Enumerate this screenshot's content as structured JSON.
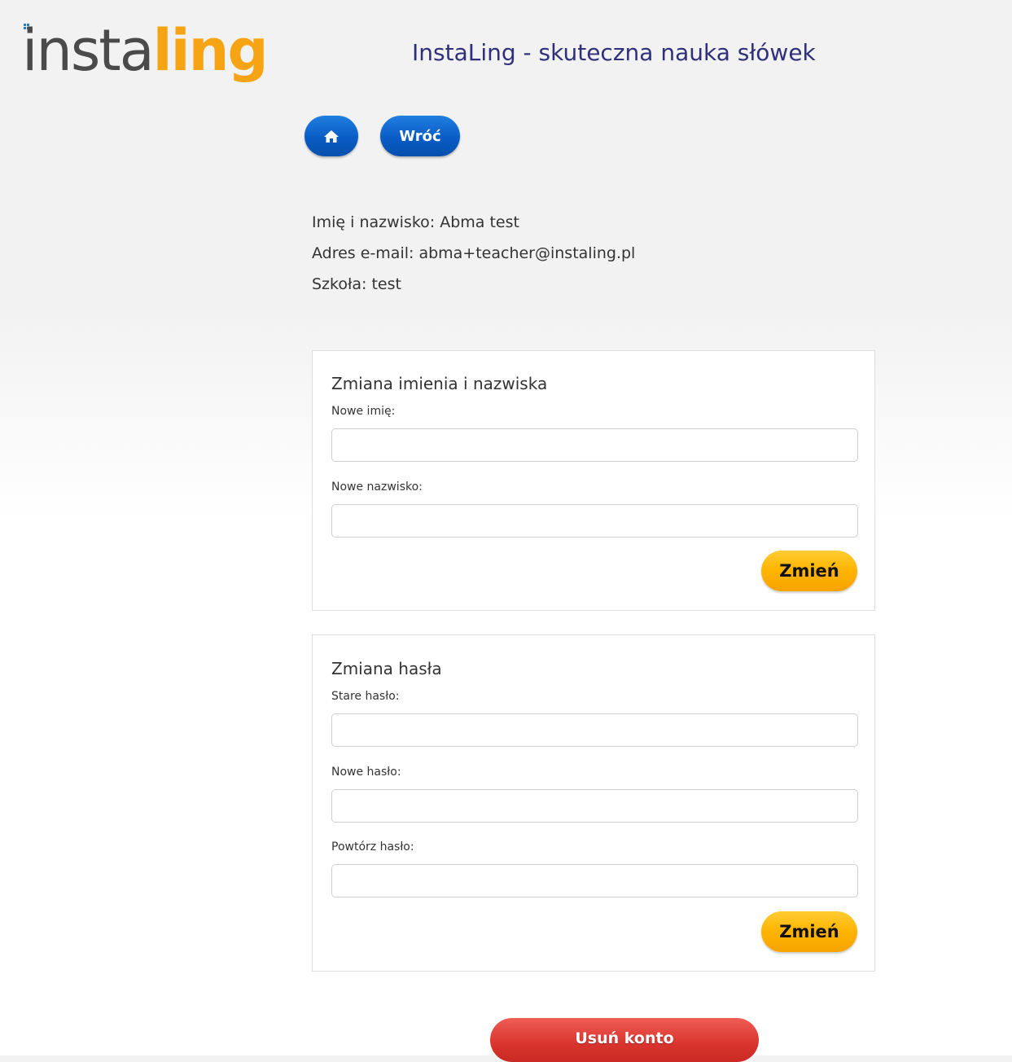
{
  "header": {
    "logo_part1": "insta",
    "logo_part2": "ling",
    "site_title": "InstaLing - skuteczna nauka słówek"
  },
  "nav": {
    "home_icon": "home-icon",
    "back_label": "Wróć"
  },
  "user_info": {
    "name_line": "Imię i nazwisko: Abma test",
    "email_line": "Adres e-mail: abma+teacher@instaling.pl",
    "school_line": "Szkoła: test"
  },
  "name_form": {
    "title": "Zmiana imienia i nazwiska",
    "first_name_label": "Nowe imię:",
    "first_name_value": "",
    "last_name_label": "Nowe nazwisko:",
    "last_name_value": "",
    "submit_label": "Zmień"
  },
  "password_form": {
    "title": "Zmiana hasła",
    "old_password_label": "Stare hasło:",
    "old_password_value": "",
    "new_password_label": "Nowe hasło:",
    "new_password_value": "",
    "repeat_password_label": "Powtórz hasło:",
    "repeat_password_value": "",
    "submit_label": "Zmień"
  },
  "delete_account": {
    "label": "Usuń konto"
  },
  "colors": {
    "logo_gray": "#4a4a4a",
    "logo_orange": "#f7a414",
    "title_navy": "#2f2f7a",
    "nav_blue": "#0a5cc5",
    "submit_yellow": "#ffb400",
    "delete_red": "#d9342e"
  }
}
